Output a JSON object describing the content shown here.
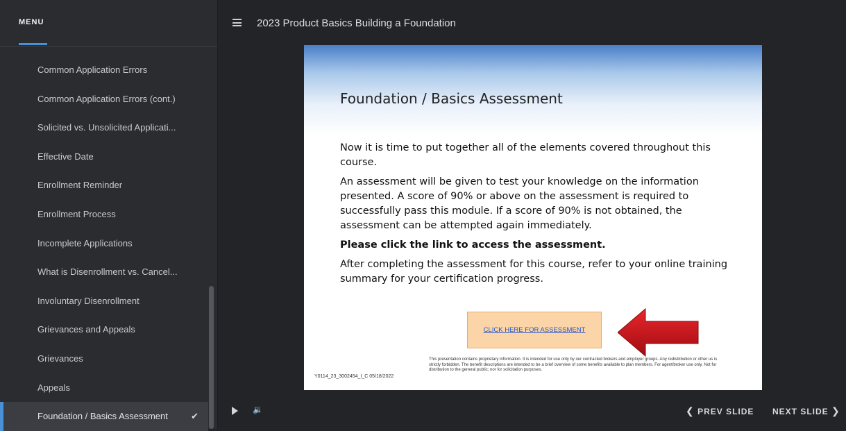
{
  "sidebar": {
    "menu_title": "MENU",
    "items": [
      {
        "label": "Common Application Errors"
      },
      {
        "label": "Common Application Errors (cont.)"
      },
      {
        "label": "Solicited vs. Unsolicited Applicati..."
      },
      {
        "label": "Effective Date"
      },
      {
        "label": "Enrollment Reminder"
      },
      {
        "label": "Enrollment Process"
      },
      {
        "label": "Incomplete Applications"
      },
      {
        "label": "What is Disenrollment vs. Cancel..."
      },
      {
        "label": "Involuntary Disenrollment"
      },
      {
        "label": "Grievances and Appeals"
      },
      {
        "label": "Grievances"
      },
      {
        "label": "Appeals"
      },
      {
        "label": "Foundation / Basics Assessment",
        "check": "✔"
      }
    ]
  },
  "topbar": {
    "course_title": "2023 Product Basics Building a Foundation"
  },
  "slide": {
    "title": "Foundation / Basics Assessment",
    "paragraphs": [
      "Now it is time to put together all of the elements covered throughout this course.",
      "An assessment will be given to test your knowledge on the information presented.  A score of 90% or above on the assessment is required to successfully pass this module.  If a score of 90% is not obtained, the assessment can be attempted again immediately.",
      "Please click the link to access the assessment.",
      "After completing the assessment for this course, refer to your online training summary for your certification progress."
    ],
    "button_label": "CLICK HERE FOR ASSESSMENT",
    "disclaimer": "This presentation contains proprietary information.  It is intended for use only by our contracted brokers and employer groups.  Any redistribution or other us is strictly forbidden.  The benefit descriptions are intended to be a brief overview of some benefits available to plan members. For agent/broker use only. Not for distribution to the general public; nor for solicitation purposes.",
    "code": "Y0114_23_3002454_I_C 05/18/2022"
  },
  "controls": {
    "prev_label": "PREV SLIDE",
    "next_label": "NEXT SLIDE",
    "prev_chevron": "❮",
    "next_chevron": "❯"
  },
  "colors": {
    "accent": "#4a90d9",
    "arrow_red": "#c8141a",
    "button_bg": "#fbd5a7"
  }
}
